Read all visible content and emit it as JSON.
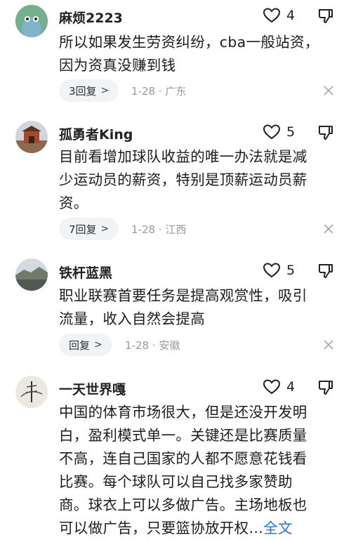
{
  "comments": [
    {
      "username": "麻烦2223",
      "likes": "4",
      "lines": [
        "所以如果发生劳资纠纷，cba一般站资，",
        "因为资真没赚到钱"
      ],
      "reply_label": "3回复",
      "meta": "1-28 · 广东"
    },
    {
      "username": "孤勇者King",
      "likes": "5",
      "lines": [
        "目前看增加球队收益的唯一办法就是减",
        "少运动员的薪资，特别是顶薪运动员薪",
        "资。"
      ],
      "reply_label": "7回复",
      "meta": "1-28 · 江西"
    },
    {
      "username": "铁杆蓝黑",
      "likes": "5",
      "lines": [
        "职业联赛首要任务是提高观赏性，吸引",
        "流量，收入自然会提高"
      ],
      "reply_label": "回复",
      "meta": "1-28 · 安徽"
    },
    {
      "username": "一天世界嘎",
      "likes": "4",
      "lines": [
        "中国的体育市场很大，但是还没开发明",
        "白，盈利模式单一。关键还是比赛质量",
        "不高，连自己国家的人都不愿意花钱看",
        "比赛。每个球队可以自己找多家赞助",
        "商。球衣上可以多做广告。主场地板也",
        "可以做广告，只要篮协放开权…"
      ],
      "more_label": "全文"
    }
  ],
  "icons": {
    "like": "heart-outline-icon",
    "dislike": "thumbs-down-icon",
    "close": "close-icon",
    "chevron": "chevron-right-icon"
  },
  "colors": {
    "link": "#2f6fc9",
    "meta": "#9a9a9a",
    "pill_bg": "#f2f3f5"
  }
}
